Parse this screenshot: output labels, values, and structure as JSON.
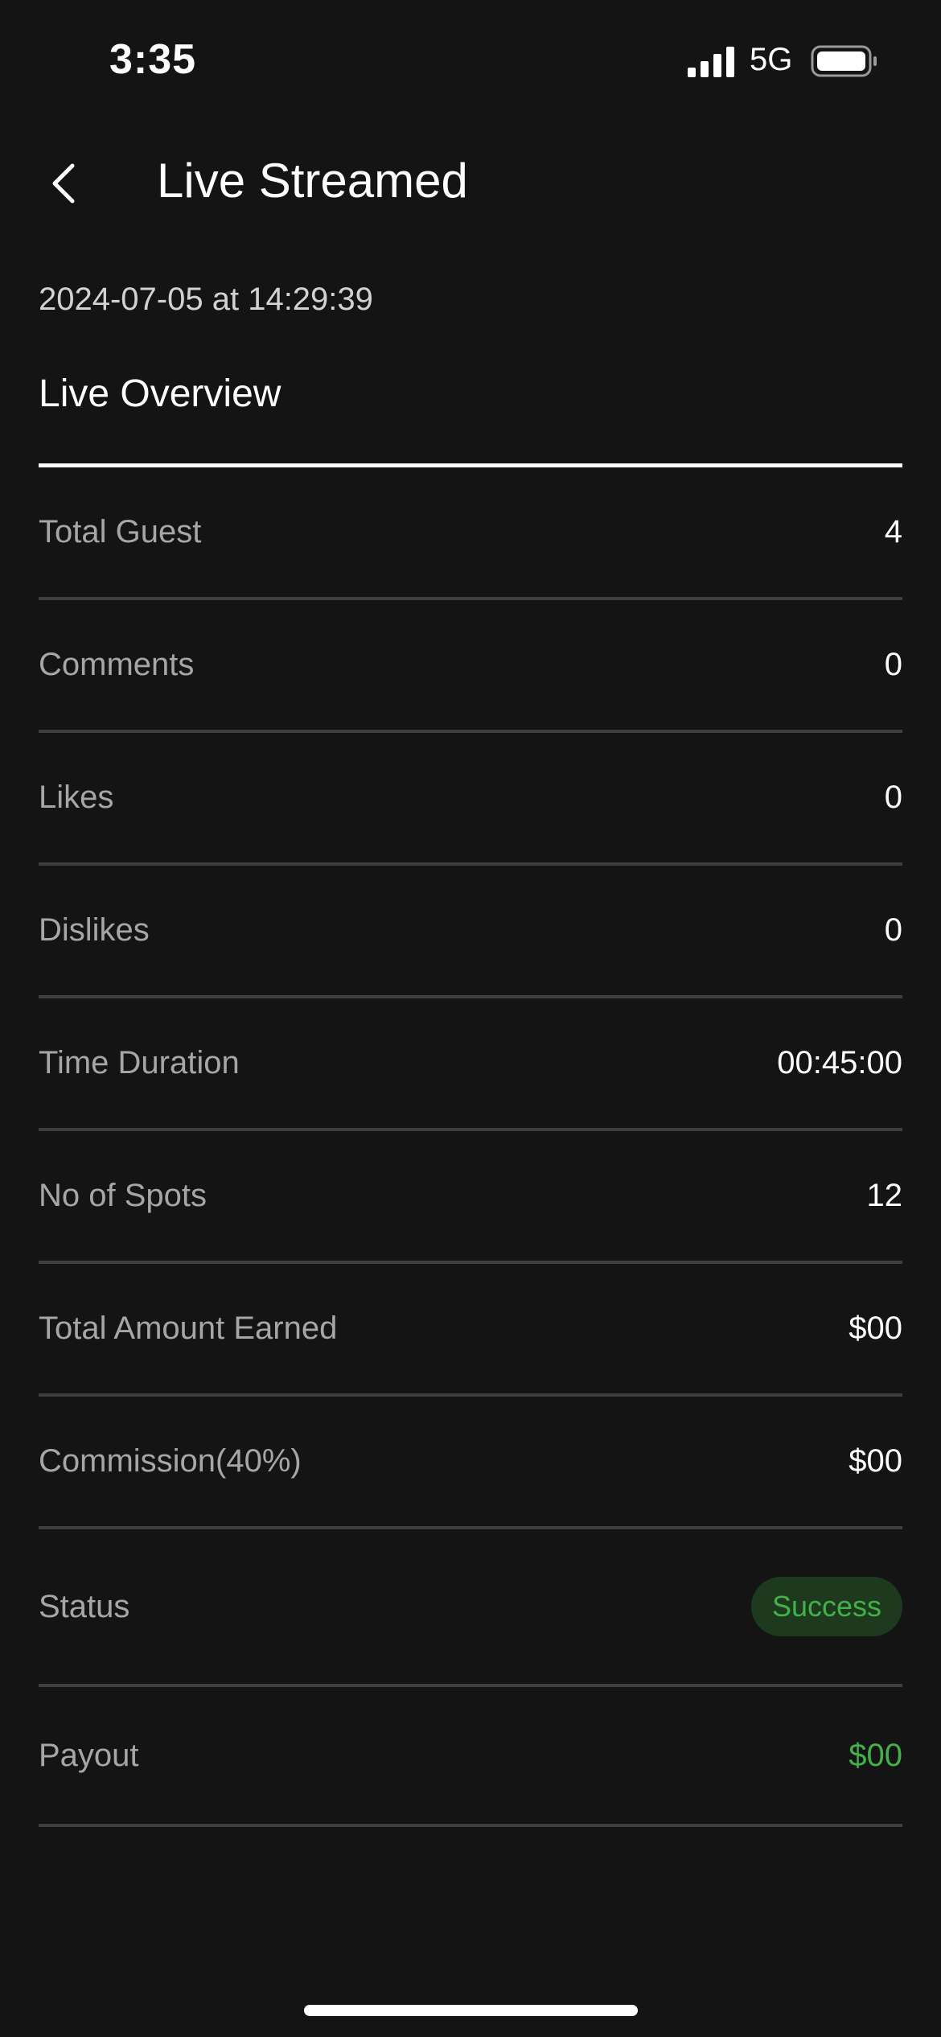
{
  "status_bar": {
    "time": "3:35",
    "network": "5G",
    "signal_icon": "cellular-signal-icon",
    "battery_icon": "battery-icon"
  },
  "header": {
    "back_icon": "chevron-left-icon",
    "title": "Live Streamed"
  },
  "timestamp": "2024-07-05 at 14:29:39",
  "section_title": "Live Overview",
  "rows": [
    {
      "label": "Total Guest",
      "value": "4"
    },
    {
      "label": "Comments",
      "value": "0"
    },
    {
      "label": "Likes",
      "value": "0"
    },
    {
      "label": "Dislikes",
      "value": "0"
    },
    {
      "label": "Time Duration",
      "value": "00:45:00"
    },
    {
      "label": "No of Spots",
      "value": "12"
    },
    {
      "label": "Total Amount Earned",
      "value": "$00"
    },
    {
      "label": "Commission(40%)",
      "value": "$00"
    },
    {
      "label": "Status",
      "value": "Success"
    },
    {
      "label": "Payout",
      "value": "$00"
    }
  ],
  "colors": {
    "background": "#141414",
    "divider": "#3f3f3f",
    "label": "#a6a6a6",
    "success_text": "#43b04a",
    "success_badge_bg": "#1d3a1f"
  }
}
